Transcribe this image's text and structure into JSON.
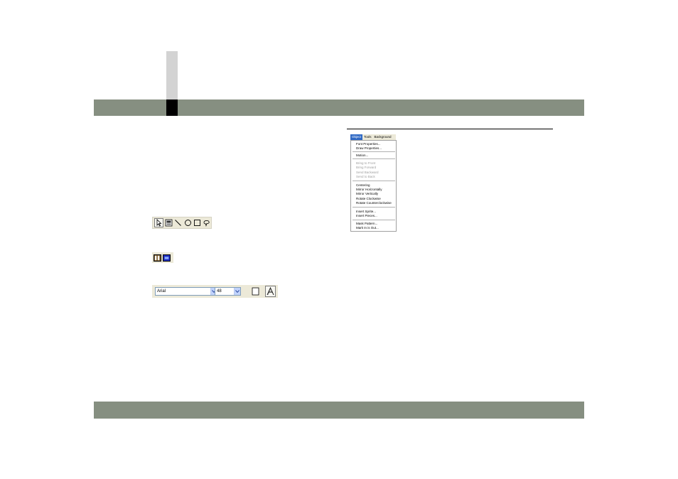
{
  "toolbars": {
    "draw_tools": [
      "pointer-tool",
      "sprite-tool",
      "line-tool",
      "ellipse-tool",
      "rectangle-tool",
      "lasso-tool"
    ],
    "colors": {
      "fg": "#7a5a2a",
      "bg": "#2030c0"
    },
    "font": {
      "family": "Arial",
      "size": "48"
    }
  },
  "menu": {
    "bar": [
      "Object",
      "Tools",
      "Background"
    ],
    "active": "Object",
    "items": [
      {
        "label": "Font Properties...",
        "disabled": false
      },
      {
        "label": "Draw Properties...",
        "disabled": false
      },
      {
        "label": "Motion...",
        "disabled": false
      },
      {
        "label": "Bring to Front",
        "disabled": true
      },
      {
        "label": "Bring Forward",
        "disabled": true
      },
      {
        "label": "Send Backward",
        "disabled": true
      },
      {
        "label": "Send to Back",
        "disabled": true
      },
      {
        "label": "Centering",
        "disabled": false
      },
      {
        "label": "Mirror Horizontally",
        "disabled": false
      },
      {
        "label": "Mirror Vertically",
        "disabled": false
      },
      {
        "label": "Rotate Clockwise",
        "disabled": false
      },
      {
        "label": "Rotate Counterclockwise",
        "disabled": false
      },
      {
        "label": "Insert Sprite...",
        "disabled": false
      },
      {
        "label": "Insert Pieces...",
        "disabled": false
      },
      {
        "label": "Mask Pattern...",
        "disabled": false
      },
      {
        "label": "Mark In is Out...",
        "disabled": false
      }
    ]
  },
  "colors": {
    "band": "#868f81",
    "menu_highlight": "#316ac5"
  }
}
